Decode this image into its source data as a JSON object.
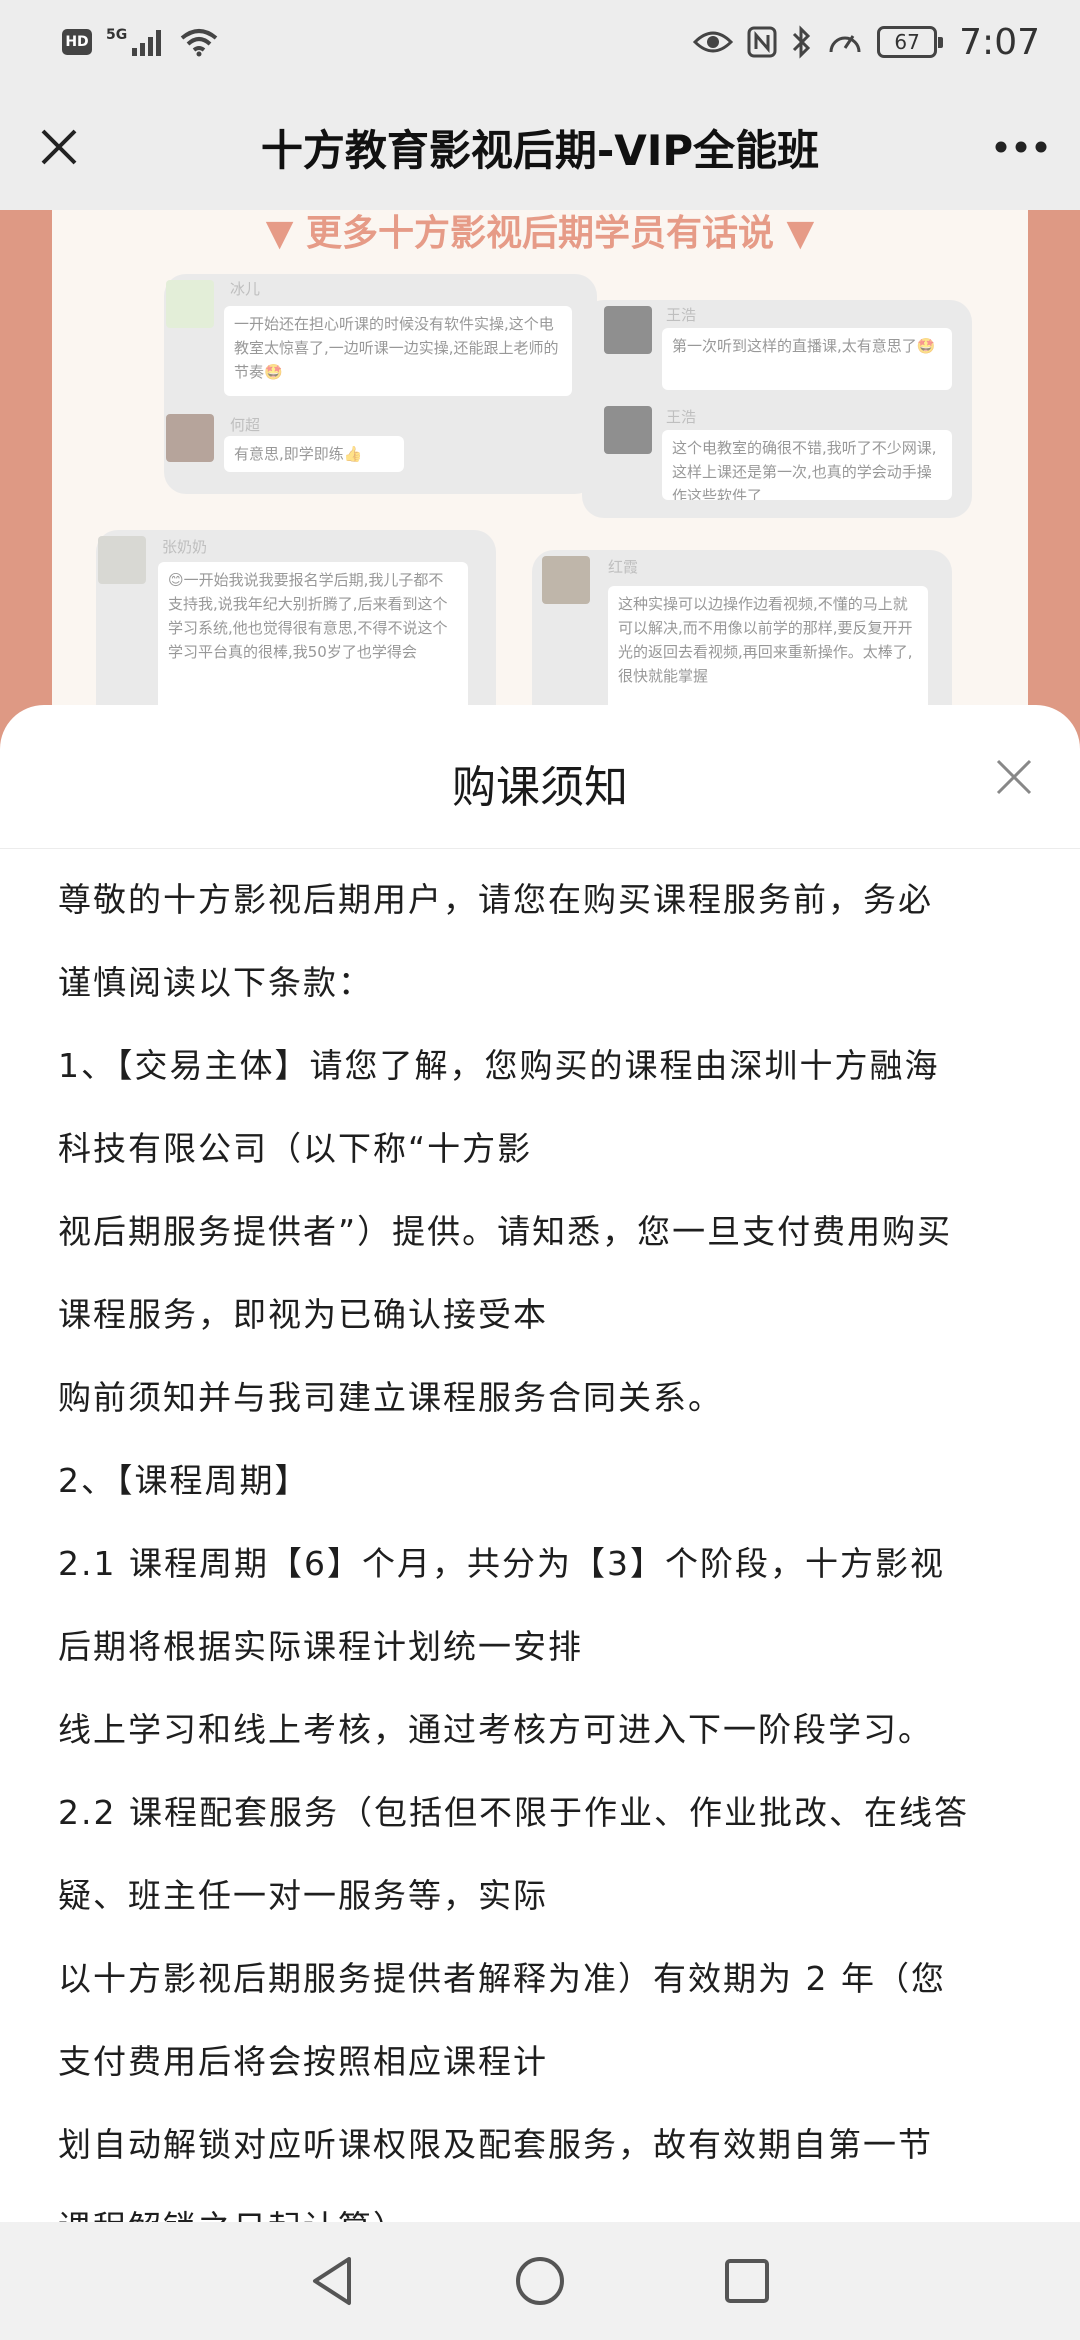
{
  "status_bar": {
    "hd_badge": "HD",
    "network": "5G",
    "battery": "67",
    "time": "7:07"
  },
  "title_bar": {
    "title": "十方教育影视后期-VIP全能班",
    "close_icon": "close-icon",
    "more_icon": "more-icon"
  },
  "background": {
    "heading": "▼ 更多十方影视后期学员有话说 ▼",
    "cards": [
      {
        "name": "冰儿",
        "text": "一开始还在担心听课的时候没有软件实操,这个电教室太惊喜了,一边听课一边实操,还能跟上老师的节奏🤩"
      },
      {
        "name": "何超",
        "text": "有意思,即学即练👍"
      },
      {
        "name": "王浩",
        "text": "第一次听到这样的直播课,太有意思了🤩"
      },
      {
        "name": "王浩",
        "text": "这个电教室的确很不错,我听了不少网课,这样上课还是第一次,也真的学会动手操作这些软件了"
      },
      {
        "name": "张奶奶",
        "text": "😊一开始我说我要报名学后期,我儿子都不支持我,说我年纪大别折腾了,后来看到这个学习系统,他也觉得很有意思,不得不说这个学习平台真的很棒,我50岁了也学得会"
      },
      {
        "name": "红霞",
        "text": "这种实操可以边操作边看视频,不懂的马上就可以解决,而不用像以前学的那样,要反复开开光的返回去看视频,再回来重新操作。太棒了,很快就能掌握"
      }
    ]
  },
  "sheet": {
    "title": "购课须知",
    "lines": [
      "尊敬的十方影视后期用户，请您在购买课程服务前，务必",
      "谨慎阅读以下条款：",
      "1、【交易主体】请您了解，您购买的课程由深圳十方融海",
      "科技有限公司（以下称“十方影",
      "视后期服务提供者”）提供。请知悉，您一旦支付费用购买",
      "课程服务，即视为已确认接受本",
      "购前须知并与我司建立课程服务合同关系。",
      "2、【课程周期】",
      "2.1 课程周期【6】个月，共分为【3】个阶段，十方影视",
      "后期将根据实际课程计划统一安排",
      "线上学习和线上考核，通过考核方可进入下一阶段学习。",
      "2.2 课程配套服务（包括但不限于作业、作业批改、在线答",
      "疑、班主任一对一服务等，实际",
      "以十方影视后期服务提供者解释为准）有效期为 2 年（您",
      "支付费用后将会按照相应课程计",
      "划自动解锁对应听课权限及配套服务，故有效期自第一节",
      "课程解锁之日起计算）"
    ]
  },
  "nav_bar": {
    "back_icon": "back-icon",
    "home_icon": "home-icon",
    "recents_icon": "recents-icon"
  }
}
